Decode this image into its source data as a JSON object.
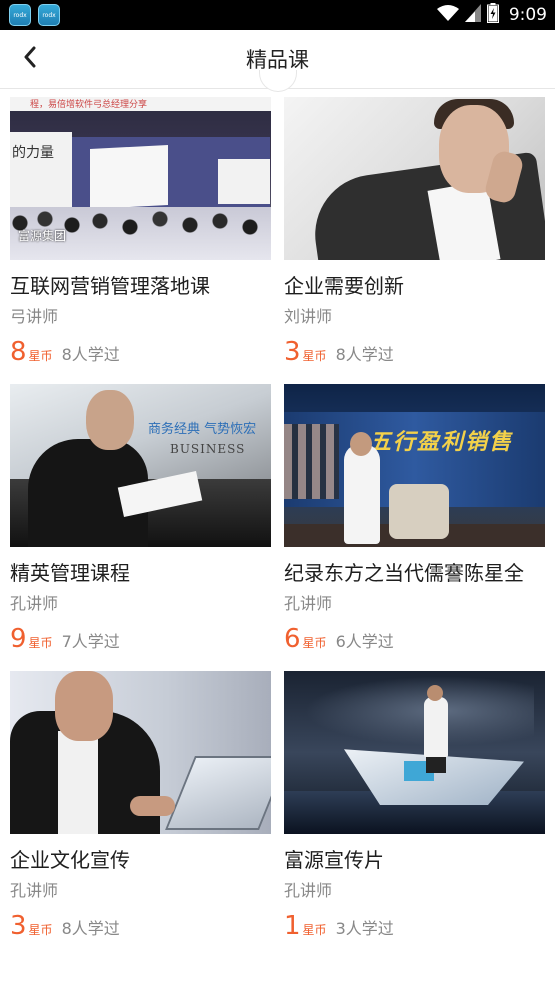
{
  "status_bar": {
    "time": "9:09",
    "app_icon_label": "rodx"
  },
  "header": {
    "title": "精品课",
    "back_icon": "chevron-left-icon"
  },
  "courses": [
    {
      "title": "互联网营销管理落地课",
      "teacher": "弓讲师",
      "price": "8",
      "price_unit": "星币",
      "learners": "8人学过",
      "thumb_banner": "程，易倍增软件弓总经理分享",
      "thumb_side": "的力量",
      "thumb_watermark": "富源集团"
    },
    {
      "title": "企业需要创新",
      "teacher": "刘讲师",
      "price": "3",
      "price_unit": "星币",
      "learners": "8人学过"
    },
    {
      "title": "精英管理课程",
      "teacher": "孔讲师",
      "price": "9",
      "price_unit": "星币",
      "learners": "7人学过",
      "thumb_tagline": "商务经典 气势恢宏",
      "thumb_business": "BUSINESS"
    },
    {
      "title": "纪录东方之当代儒謇陈星全",
      "teacher": "孔讲师",
      "price": "6",
      "price_unit": "星币",
      "learners": "6人学过",
      "thumb_slogan": "五行盈利销售"
    },
    {
      "title": "企业文化宣传",
      "teacher": "孔讲师",
      "price": "3",
      "price_unit": "星币",
      "learners": "8人学过"
    },
    {
      "title": "富源宣传片",
      "teacher": "孔讲师",
      "price": "1",
      "price_unit": "星币",
      "learners": "3人学过"
    }
  ],
  "colors": {
    "accent": "#f0602f",
    "secondary_text": "#888888",
    "title_text": "#1e1e1e"
  }
}
